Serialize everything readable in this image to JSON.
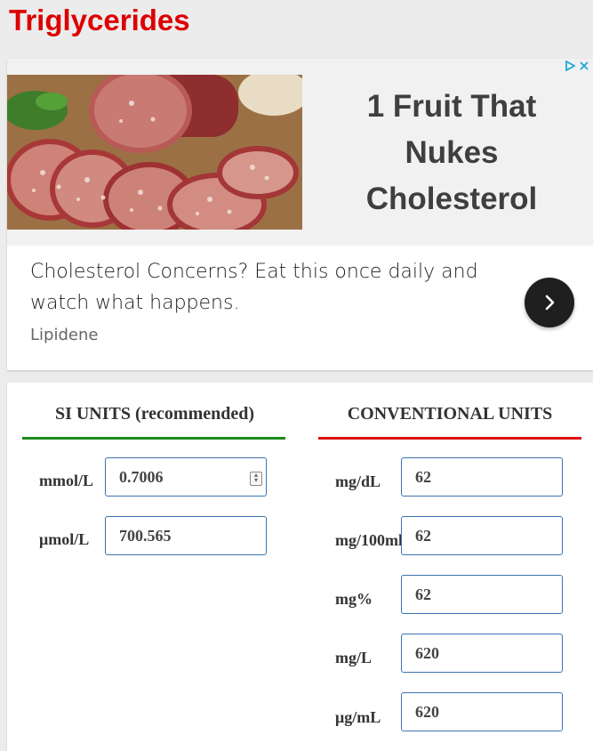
{
  "page": {
    "title": "Triglycerides"
  },
  "ad": {
    "headline": "1 Fruit That Nukes Cholesterol",
    "body": "Cholesterol Concerns? Eat this once daily and watch what happens.",
    "brand": "Lipidene",
    "image_icon": "sliced-salami-image",
    "choices_icon": "adchoices-icon",
    "close_icon": "close-icon",
    "arrow_icon": "chevron-right-icon"
  },
  "converter": {
    "si": {
      "heading": "SI UNITS (recommended)",
      "accent": "#1d8a1d",
      "fields": [
        {
          "label": "mmol/L",
          "value": "0.7006"
        },
        {
          "label": "μmol/L",
          "value": "700.565"
        }
      ]
    },
    "conventional": {
      "heading": "CONVENTIONAL UNITS",
      "accent": "#dd1111",
      "fields": [
        {
          "label": "mg/dL",
          "value": "62"
        },
        {
          "label": "mg/100ml",
          "value": "62"
        },
        {
          "label": "mg%",
          "value": "62"
        },
        {
          "label": "mg/L",
          "value": "620"
        },
        {
          "label": "μg/mL",
          "value": "620"
        }
      ]
    }
  }
}
